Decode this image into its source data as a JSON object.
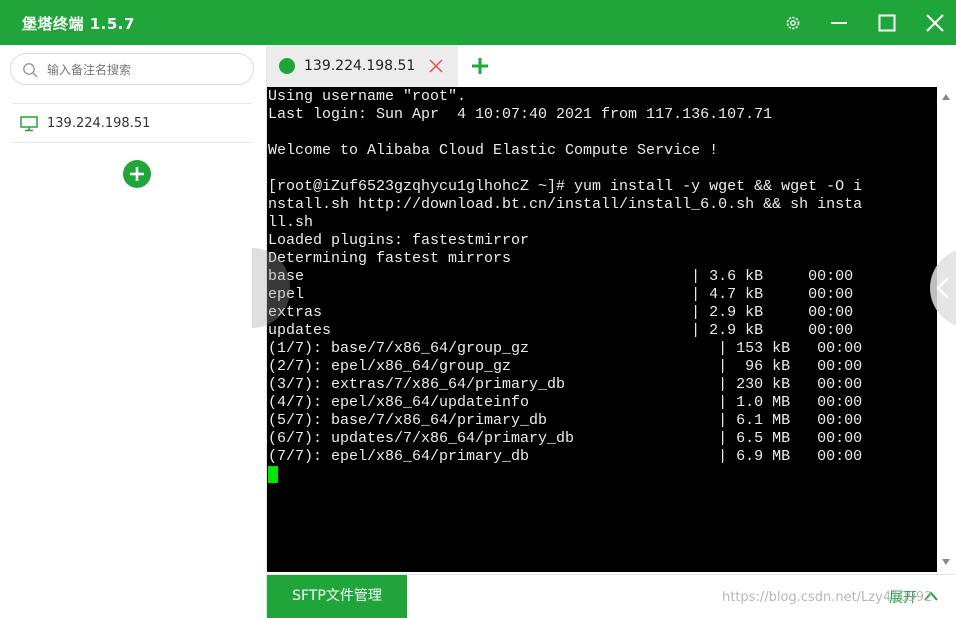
{
  "app": {
    "title": "堡塔终端 1.5.7",
    "accent_color": "#20a53a",
    "window_buttons": [
      "gear-icon",
      "minimize-icon",
      "maximize-icon",
      "close-icon"
    ]
  },
  "sidebar": {
    "search_placeholder": "输入备注名搜索",
    "hosts": [
      {
        "label": "139.224.198.51",
        "icon": "monitor-icon"
      }
    ],
    "add_icon": "plus-icon"
  },
  "tabs": [
    {
      "label": "139.224.198.51",
      "status_color": "#20a53a",
      "active": true
    }
  ],
  "terminal": {
    "cursor_color": "#00e600",
    "lines": [
      "Using username \"root\".",
      "Last login: Sun Apr  4 10:07:40 2021 from 117.136.107.71",
      "",
      "Welcome to Alibaba Cloud Elastic Compute Service !",
      "",
      "[root@iZuf6523gzqhycu1glhohcZ ~]# yum install -y wget && wget -O i",
      "nstall.sh http://download.bt.cn/install/install_6.0.sh && sh insta",
      "ll.sh",
      "Loaded plugins: fastestmirror",
      "Determining fastest mirrors",
      "base                                           | 3.6 kB     00:00",
      "epel                                           | 4.7 kB     00:00",
      "extras                                         | 2.9 kB     00:00",
      "updates                                        | 2.9 kB     00:00",
      "(1/7): base/7/x86_64/group_gz                     | 153 kB   00:00",
      "(2/7): epel/x86_64/group_gz                       |  96 kB   00:00",
      "(3/7): extras/7/x86_64/primary_db                 | 230 kB   00:00",
      "(4/7): epel/x86_64/updateinfo                     | 1.0 MB   00:00",
      "(5/7): base/7/x86_64/primary_db                   | 6.1 MB   00:00",
      "(6/7): updates/7/x86_64/primary_db                | 6.5 MB   00:00",
      "(7/7): epel/x86_64/primary_db                     | 6.9 MB   00:00"
    ]
  },
  "bottom": {
    "sftp_label": "SFTP文件管理",
    "expand_label": "展开",
    "watermark": "https://blog.csdn.net/Lzy410992"
  }
}
